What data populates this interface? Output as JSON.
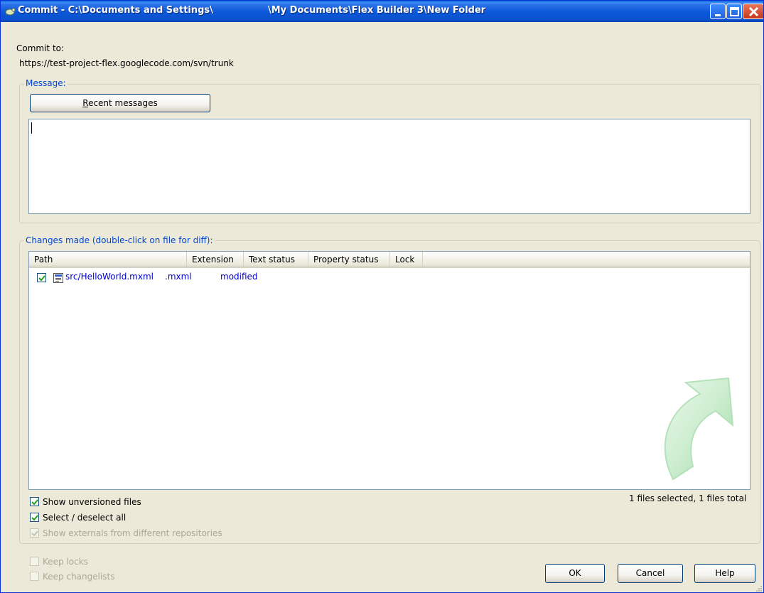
{
  "window": {
    "title_left": "Commit - C:\\Documents and Settings\\",
    "title_right": "\\My Documents\\Flex Builder 3\\New Folder",
    "title_icon": "tortoise-icon"
  },
  "commit_to": {
    "label": "Commit to:",
    "url": "https://test-project-flex.googlecode.com/svn/trunk"
  },
  "message": {
    "group_label": "Message:",
    "recent_button_label": "Recent messages",
    "recent_button_mnemonic": "R",
    "recent_button_rest": "ecent messages",
    "text": ""
  },
  "changes": {
    "group_label": "Changes made (double-click on file for diff):",
    "columns": [
      "Path",
      "Extension",
      "Text status",
      "Property status",
      "Lock"
    ],
    "rows": [
      {
        "checked": true,
        "path": "src/HelloWorld.mxml",
        "extension": ".mxml",
        "text_status": "modified",
        "property_status": "",
        "lock": ""
      }
    ],
    "summary": "1 files selected, 1 files total"
  },
  "options": {
    "show_unversioned": {
      "label": "Show unversioned files",
      "checked": true,
      "enabled": true
    },
    "select_all": {
      "label": "Select / deselect all",
      "checked": true,
      "enabled": true
    },
    "show_externals": {
      "label": "Show externals from different repositories",
      "checked": true,
      "enabled": false
    },
    "keep_locks": {
      "label": "Keep locks",
      "checked": false,
      "enabled": false
    },
    "keep_changelists": {
      "label": "Keep changelists",
      "checked": false,
      "enabled": false
    }
  },
  "buttons": {
    "ok": "OK",
    "cancel": "Cancel",
    "help": "Help"
  },
  "colors": {
    "title_bar": "#0a53cf",
    "group_label": "#0046d5",
    "status_text": "#0000c8",
    "dialog_bg": "#ece9d8"
  }
}
